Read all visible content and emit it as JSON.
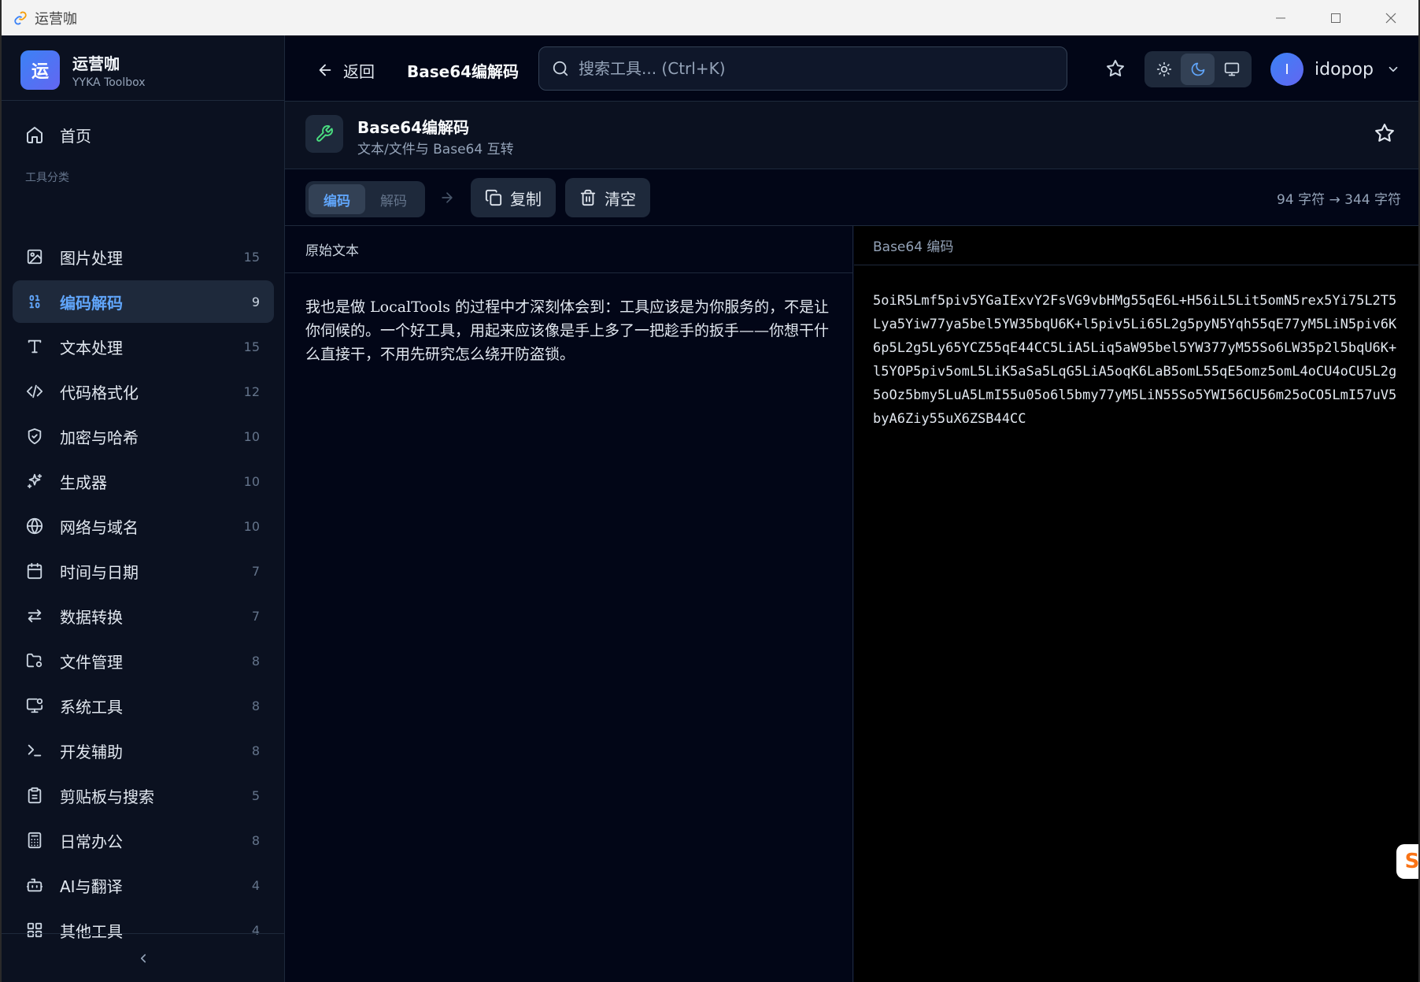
{
  "window": {
    "title": "运营咖"
  },
  "brand": {
    "logo_char": "运",
    "name": "运营咖",
    "subtitle": "YYKA Toolbox"
  },
  "nav": {
    "home_label": "首页",
    "section_label": "工具分类",
    "items": [
      {
        "label": "图片处理",
        "count": "15",
        "icon": "image-icon"
      },
      {
        "label": "编码解码",
        "count": "9",
        "icon": "binary-icon",
        "active": true
      },
      {
        "label": "文本处理",
        "count": "15",
        "icon": "text-icon"
      },
      {
        "label": "代码格式化",
        "count": "12",
        "icon": "code-icon"
      },
      {
        "label": "加密与哈希",
        "count": "10",
        "icon": "shield-icon"
      },
      {
        "label": "生成器",
        "count": "10",
        "icon": "sparkles-icon"
      },
      {
        "label": "网络与域名",
        "count": "10",
        "icon": "globe-icon"
      },
      {
        "label": "时间与日期",
        "count": "7",
        "icon": "calendar-icon"
      },
      {
        "label": "数据转换",
        "count": "7",
        "icon": "swap-icon"
      },
      {
        "label": "文件管理",
        "count": "8",
        "icon": "folder-cog-icon"
      },
      {
        "label": "系统工具",
        "count": "8",
        "icon": "monitor-cog-icon"
      },
      {
        "label": "开发辅助",
        "count": "8",
        "icon": "terminal-icon"
      },
      {
        "label": "剪贴板与搜索",
        "count": "5",
        "icon": "clipboard-icon"
      },
      {
        "label": "日常办公",
        "count": "8",
        "icon": "calculator-icon"
      },
      {
        "label": "AI与翻译",
        "count": "4",
        "icon": "bot-icon"
      },
      {
        "label": "其他工具",
        "count": "4",
        "icon": "grid-icon"
      }
    ]
  },
  "header": {
    "back_label": "返回",
    "title": "Base64编解码",
    "search_placeholder": "搜索工具... (Ctrl+K)",
    "user_initial": "I",
    "username": "idopop"
  },
  "tool": {
    "name": "Base64编解码",
    "description": "文本/文件与 Base64 互转"
  },
  "toolbar": {
    "encode_label": "编码",
    "decode_label": "解码",
    "copy_label": "复制",
    "clear_label": "清空",
    "char_count": "94 字符 → 344 字符"
  },
  "panes": {
    "input_title": "原始文本",
    "output_title": "Base64 编码",
    "input_text": "我也是做 LocalTools 的过程中才深刻体会到：工具应该是为你服务的，不是让你伺候的。一个好工具，用起来应该像是手上多了一把趁手的扳手——你想干什么直接干，不用先研究怎么绕开防盗锁。",
    "output_text": "5oiR5Lmf5piv5YGaIExvY2FsVG9vbHMg55qE6L+H56iL5Lit5omN5rex5Yi75L2T5Lya5Yiw77ya5bel5YW35bqU6K+l5piv5Li65L2g5pyN5Yqh55qE77yM5LiN5piv6K6p5L2g5Ly65YCZ55qE44CC5LiA5Liq5aW95bel5YW377yM55So6LW35p2l5bqU6K+l5YOP5piv5omL5LiK5aSa5LqG5LiA5oqK6LaB5omL55qE5omz5omL4oCU4oCU5L2g5oOz5bmy5LuA5LmI55u05o6l5bmy77yM5LiN55So5YWI56CU56m25oCO5LmI57uV5byA6Ziy55uX6ZSB44CC"
  },
  "colors": {
    "accent": "#60a5fa",
    "background": "#020617",
    "sidebar": "#0b1120"
  }
}
